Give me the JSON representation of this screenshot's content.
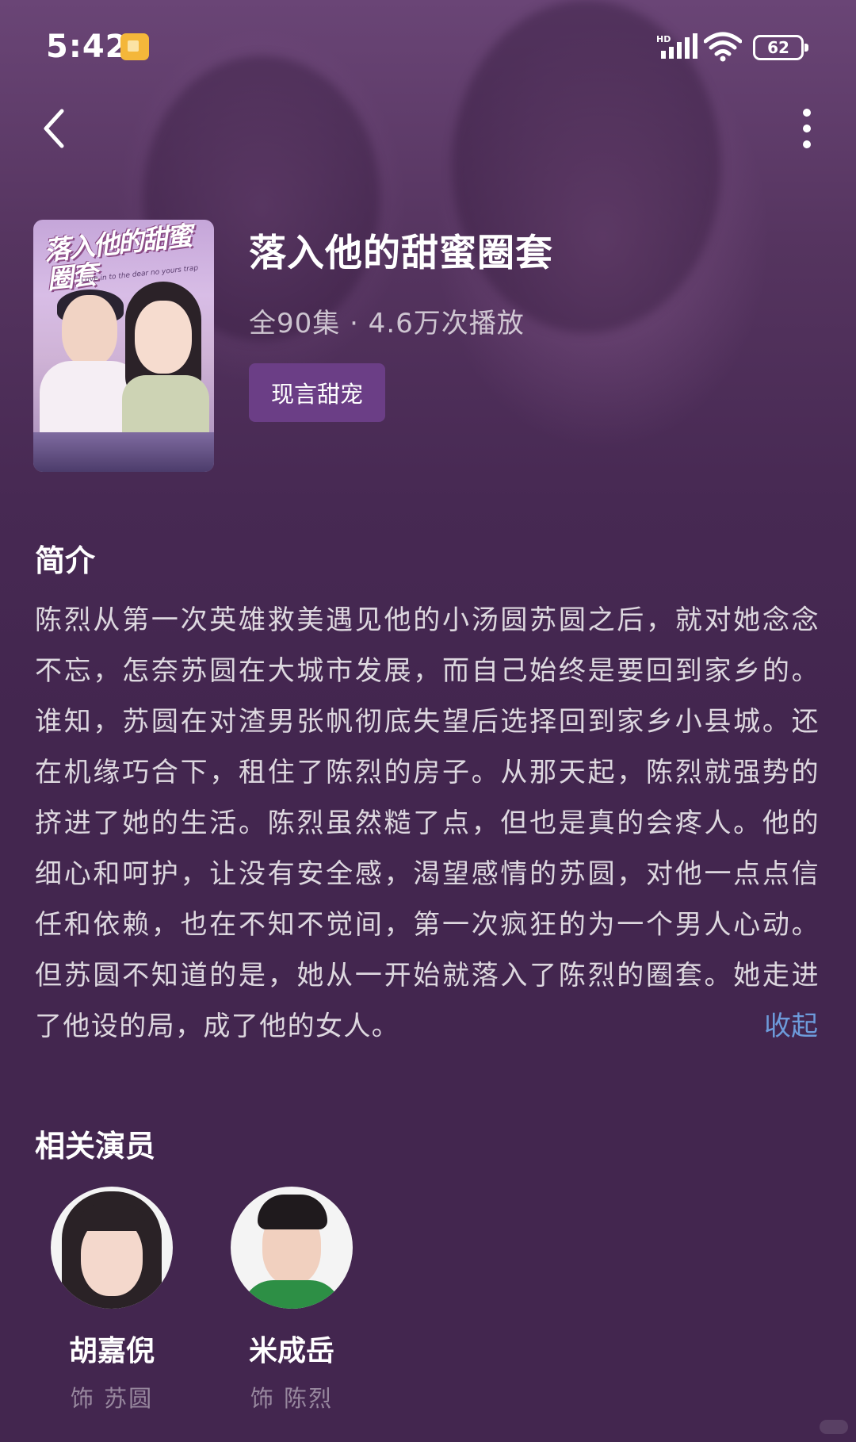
{
  "status_bar": {
    "time": "5:42",
    "signal_label": "HD",
    "battery": "62"
  },
  "nav": {
    "back_icon": "chevron-left-icon",
    "more_icon": "more-vertical-icon"
  },
  "drama": {
    "poster_title": "落入他的甜蜜圈套",
    "poster_subtitle": "Love in to the dear no yours trap",
    "title": "落入他的甜蜜圈套",
    "meta": "全90集 · 4.6万次播放",
    "genre_tag": "现言甜宠"
  },
  "synopsis": {
    "heading": "简介",
    "text": "陈烈从第一次英雄救美遇见他的小汤圆苏圆之后，就对她念念不忘，怎奈苏圆在大城市发展，而自己始终是要回到家乡的。谁知，苏圆在对渣男张帆彻底失望后选择回到家乡小县城。还在机缘巧合下，租住了陈烈的房子。从那天起，陈烈就强势的挤进了她的生活。陈烈虽然糙了点，但也是真的会疼人。他的细心和呵护，让没有安全感，渴望感情的苏圆，对他一点点信任和依赖，也在不知不觉间，第一次疯狂的为一个男人心动。但苏圆不知道的是，她从一开始就落入了陈烈的圈套。她走进了他设的局，成了他的女人。",
    "collapse_label": "收起"
  },
  "cast": {
    "heading": "相关演员",
    "actors": [
      {
        "name": "胡嘉倪",
        "role": "饰 苏圆"
      },
      {
        "name": "米成岳",
        "role": "饰 陈烈"
      }
    ]
  },
  "colors": {
    "background": "#43264f",
    "tag_bg": "#6b3e86",
    "link": "#6d9bdb"
  }
}
